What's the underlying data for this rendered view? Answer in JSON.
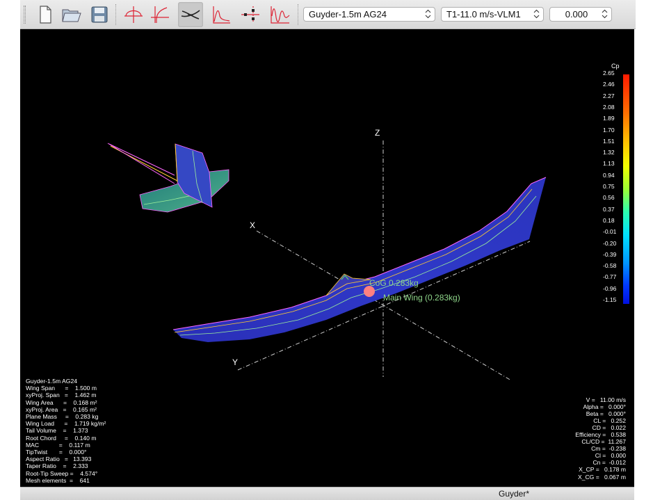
{
  "toolbar": {
    "plane_select": "Guyder-1.5m AG24",
    "polar_select": "T1-11.0 m/s-VLM1",
    "opp_select": "0.000"
  },
  "view": {
    "axis_x": "X",
    "axis_y": "Y",
    "axis_z": "Z",
    "cog_label": "CoG   0.283kg",
    "wing_label": "Main Wing (0.283kg)"
  },
  "legend": {
    "title": "Cp",
    "ticks": [
      "2.65",
      "2.46",
      "2.27",
      "2.08",
      "1.89",
      "1.70",
      "1.51",
      "1.32",
      "1.13",
      "0.94",
      "0.75",
      "0.56",
      "0.37",
      "0.18",
      "-0.01",
      "-0.20",
      "-0.39",
      "-0.58",
      "-0.77",
      "-0.96",
      "-1.15"
    ]
  },
  "plane_info": [
    "Guyder-1.5m AG24",
    "Wing Span      =    1.500 m",
    "xyProj. Span   =    1.462 m",
    "Wing Area      =    0.168 m²",
    "xyProj. Area   =    0.165 m²",
    "Plane Mass     =    0.283 kg",
    "Wing Load      =    1.719 kg/m²",
    "Tail Volume    =    1.373",
    "Root Chord     =    0.140 m",
    "MAC            =    0.117 m",
    "TipTwist       =    0.000°",
    "Aspect Ratio   =   13.393",
    "Taper Ratio    =    2.333",
    "Root-Tip Sweep =    4.574°",
    "Mesh elements  =    641"
  ],
  "results": [
    "V =   11.00 m/s",
    "Alpha =   0.000°",
    "Beta =   0.000°",
    "CL =   0.252",
    "CD =   0.022",
    "Efficiency =   0.538",
    "CL/CD =  11.267",
    "Cm =  -0.238",
    "Cl =   0.000",
    "Cn =  -0.012",
    "X_CP =   0.178 m",
    "X_CG =   0.067 m"
  ],
  "status": {
    "title": "Guyder*"
  }
}
